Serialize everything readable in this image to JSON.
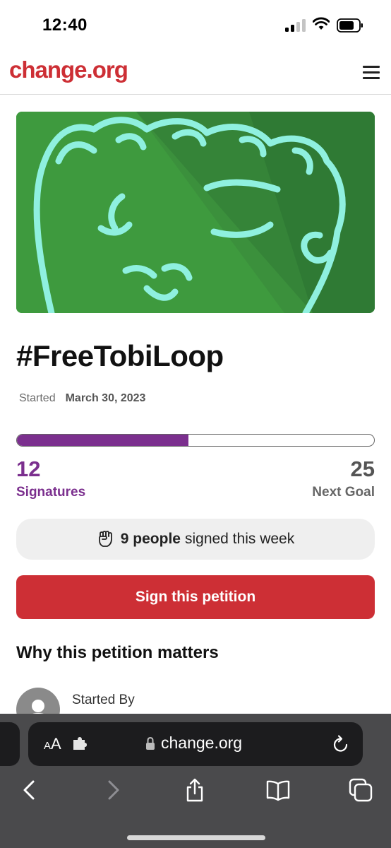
{
  "status_bar": {
    "time": "12:40"
  },
  "header": {
    "logo_text": "change.org"
  },
  "petition": {
    "title": "#FreeTobiLoop",
    "started_label": "Started",
    "started_date": "March 30, 2023",
    "signatures_count": "12",
    "signatures_label": "Signatures",
    "goal_count": "25",
    "goal_label": "Next Goal",
    "progress_fraction": 0.48,
    "week_bold": "9 people",
    "week_rest": "signed this week",
    "sign_button_label": "Sign this petition",
    "why_heading": "Why this petition matters",
    "started_by_label": "Started By"
  },
  "browser": {
    "text_size_label_small": "A",
    "text_size_label_large": "A",
    "url": "change.org"
  },
  "colors": {
    "brand_red": "#cd2f35",
    "progress_purple": "#7b2f8e",
    "hero_green": "#3f9a3f"
  },
  "icons": [
    "menu-icon",
    "fist-icon",
    "avatar-icon",
    "extension-icon",
    "lock-icon",
    "reload-icon",
    "back-icon",
    "forward-icon",
    "share-icon",
    "bookmarks-icon",
    "tabs-icon"
  ]
}
